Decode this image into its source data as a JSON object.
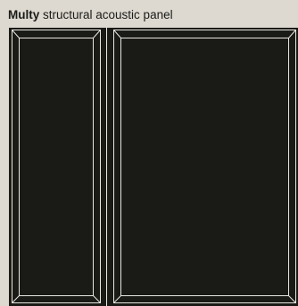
{
  "caption": {
    "brand": "Multy",
    "description": "structural acoustic panel"
  },
  "panels": {
    "count": 2,
    "colors": {
      "background": "#ddd9d1",
      "panel_fill": "#1a1a16",
      "bevel_lines": "#e8e6e0",
      "caption_text": "#1b1b18"
    }
  }
}
